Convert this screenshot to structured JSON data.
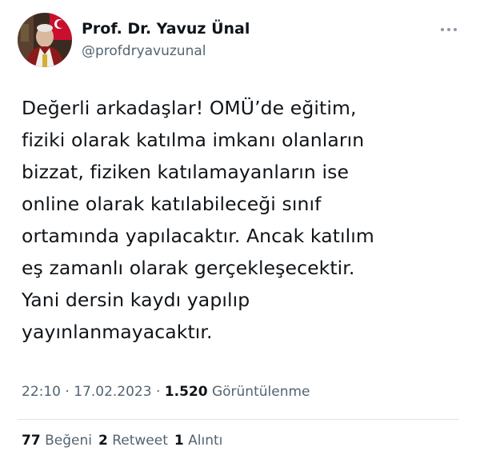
{
  "author": {
    "display_name": "Prof. Dr. Yavuz Ünal",
    "handle": "@profdryavuzunal"
  },
  "tweet": {
    "lines": [
      "Değerli arkadaşlar! OMÜ’de eğitim,",
      "fiziki olarak katılma imkanı olanların",
      "bizzat, fiziken katılamayanların ise",
      "online olarak katılabileceği sınıf",
      "ortamında yapılacaktır. Ancak katılım",
      "eş zamanlı olarak gerçekleşecektir.",
      "Yani dersin kaydı yapılıp",
      "yayınlanmayacaktır."
    ]
  },
  "meta": {
    "time": "22:10",
    "separator": "·",
    "date": "17.02.2023",
    "views_count": "1.520",
    "views_label": "Görüntülenme"
  },
  "stats": {
    "likes_count": "77",
    "likes_label": "Beğeni",
    "retweets_count": "2",
    "retweets_label": "Retweet",
    "quotes_count": "1",
    "quotes_label": "Alıntı"
  },
  "icons": {
    "more": "more-horizontal-icon"
  },
  "colors": {
    "text": "#0f1419",
    "secondary": "#536471",
    "divider": "#dde3e8"
  }
}
